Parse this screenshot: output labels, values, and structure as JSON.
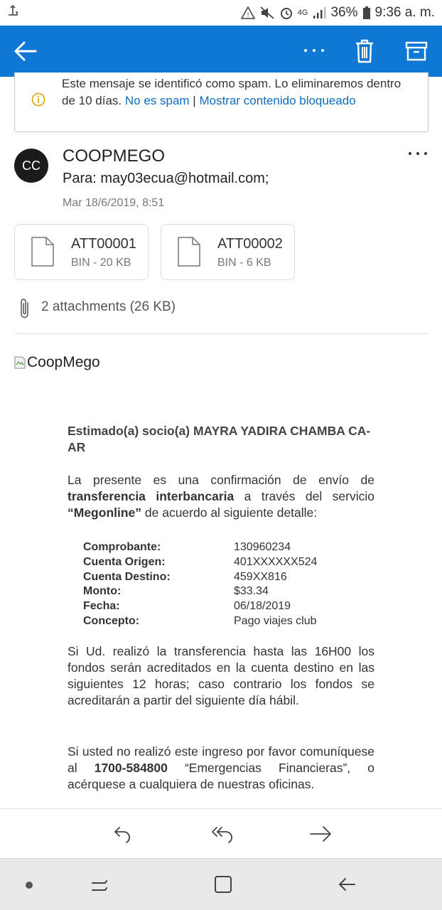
{
  "status_bar": {
    "battery": "36%",
    "time": "9:36 a. m.",
    "network": "4G"
  },
  "app_bar": {
    "icons": [
      "back-arrow-icon",
      "more-icon",
      "trash-icon",
      "archive-icon"
    ],
    "color": "#0f78d4"
  },
  "spam_banner": {
    "message": "Este mensaje se identificó como spam. Lo eliminaremos dentro de 10 días.",
    "not_spam_link": "No es spam",
    "separator": "|",
    "show_content_link": "Mostrar contenido bloqueado"
  },
  "sender": {
    "initials": "CC",
    "name": "COOPMEGO",
    "to": "Para: may03ecua@hotmail.com;",
    "date": "Mar 18/6/2019, 8:51"
  },
  "attachments": {
    "items": [
      {
        "name": "ATT00001",
        "size": "BIN - 20 KB"
      },
      {
        "name": "ATT00002",
        "size": "BIN - 6 KB"
      }
    ],
    "summary": "2 attachments (26 KB)"
  },
  "email_body": {
    "image_alt": "CoopMego",
    "greeting": "Estimado(a) socio(a) MAYRA YADIRA CHAMBA CA-AR",
    "intro_1": "La presente es una confirmación de envío de ",
    "intro_bold_1": "transferencia interbancaria",
    "intro_2": " a través del servicio ",
    "intro_bold_2": "“Megonline”",
    "intro_3": " de acuerdo al siguiente detalle:",
    "details": [
      {
        "label": "Comprobante:",
        "value": "130960234"
      },
      {
        "label": "Cuenta Origen:",
        "value": "401XXXXXX524"
      },
      {
        "label": "Cuenta Destino:",
        "value": "459XX816"
      },
      {
        "label": "Monto:",
        "value": "$33.34"
      },
      {
        "label": "Fecha:",
        "value": "06/18/2019"
      },
      {
        "label": "Concepto:",
        "value": "Pago viajes club"
      }
    ],
    "para_2": "Si Ud. realizó la transferencia hasta las 16H00 los fondos serán acreditados en la cuenta destino en las siguientes 12 horas; caso contrario los fondos se acreditarán a partir del siguiente día hábil.",
    "para_3_a": "Si usted no realizó este ingreso por favor comuníquese al ",
    "para_3_bold": "1700-584800",
    "para_3_b": " “Emergencias Financieras”, o acérquese a cualquiera de nuestras oficinas."
  },
  "action_bar": {
    "icons": [
      "reply-icon",
      "reply-all-icon",
      "forward-icon"
    ]
  },
  "system_nav": {
    "icons": [
      "dot-icon",
      "recents-icon",
      "home-icon",
      "back-icon"
    ]
  }
}
